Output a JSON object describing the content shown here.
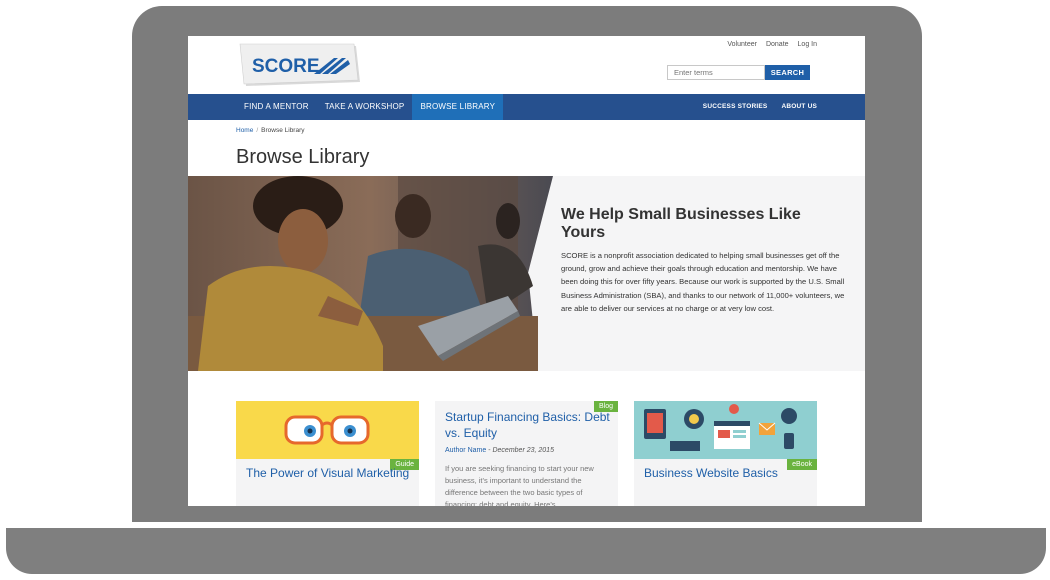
{
  "util_links": [
    "Volunteer",
    "Donate",
    "Log In"
  ],
  "logo_text": "SCORE",
  "search": {
    "placeholder": "Enter terms",
    "button": "SEARCH"
  },
  "nav": {
    "left": [
      "FIND A MENTOR",
      "TAKE A WORKSHOP",
      "BROWSE LIBRARY"
    ],
    "right": [
      "SUCCESS STORIES",
      "ABOUT US"
    ]
  },
  "breadcrumb": {
    "home": "Home",
    "current": "Browse Library"
  },
  "page_title": "Browse Library",
  "hero": {
    "heading": "We Help Small Businesses Like Yours",
    "body": "SCORE is a nonprofit association dedicated to helping small businesses get off the ground, grow and achieve their goals through education and mentorship. We have been doing this for over fifty years. Because our work is supported by the U.S. Small Business Administration (SBA), and thanks to our network of 11,000+ volunteers, we are able to deliver our services at no charge or at very low cost."
  },
  "cards": [
    {
      "title": "The Power of Visual Marketing",
      "tag": "Guide"
    },
    {
      "title": "Startup Financing Basics: Debt vs. Equity",
      "tag": "Blog",
      "author": "Author Name",
      "date": "December 23, 2015",
      "excerpt": "If you are seeking financing to start your new business, it's important to understand the difference between the two basic types of financing: debt and equity. Here's"
    },
    {
      "title": "Business Website Basics",
      "tag": "eBook"
    }
  ],
  "colors": {
    "nav": "#26508e",
    "nav_active": "#1f6fb8",
    "tag": "#6ab33f",
    "link": "#1f5fa8"
  }
}
